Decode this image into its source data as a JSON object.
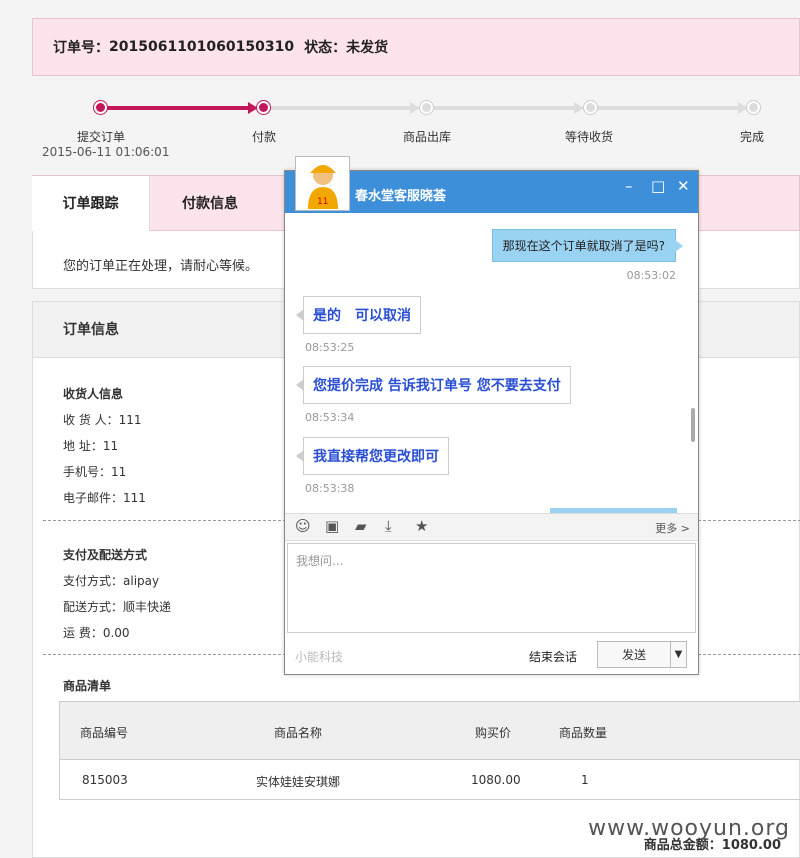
{
  "order": {
    "label": "订单号：",
    "number": "2015061101060150310",
    "status_label": "状态：",
    "status": "未发货"
  },
  "progress": {
    "steps": [
      "提交订单",
      "付款",
      "商品出库",
      "等待收货",
      "完成"
    ],
    "time": "2015-06-11 01:06:01"
  },
  "tabs": {
    "tracking": "订单跟踪",
    "payment": "付款信息",
    "notice": "您的订单正在处理，请耐心等候。"
  },
  "info": {
    "title": "订单信息",
    "receiver_title": "收货人信息",
    "receiver": [
      "收 货 人：111",
      "地    址：11",
      "手机号：11",
      "电子邮件：111"
    ],
    "pay_title": "支付及配送方式",
    "pay": [
      "支付方式：alipay",
      "配送方式：顺丰快递",
      "运    费：0.00"
    ],
    "goods_title": "商品清单",
    "headers": [
      "商品编号",
      "商品名称",
      "购买价",
      "商品数量"
    ],
    "row": [
      "815003",
      "实体娃娃安琪娜",
      "1080.00",
      "1"
    ],
    "total": "商品总金额：1080.00"
  },
  "watermark": "www.wooyun.org",
  "chat": {
    "name": "春水堂客服晓荟",
    "avatar_number": "11",
    "messages": {
      "user1": "那现在这个订单就取消了是吗?",
      "t1": "08:53:02",
      "a1": "是的　可以取消",
      "t2": "08:53:25",
      "a2": "您提价完成 告诉我订单号 您不要去支付",
      "t3": "08:53:34",
      "a3": "我直接帮您更改即可",
      "t4": "08:53:38"
    },
    "more": "更多 >",
    "placeholder": "我想问...",
    "brand": "小能科技",
    "end": "结束会话",
    "send": "发送",
    "icons": [
      "smile-icon",
      "image-icon",
      "folder-icon",
      "download-icon",
      "star-icon"
    ]
  }
}
